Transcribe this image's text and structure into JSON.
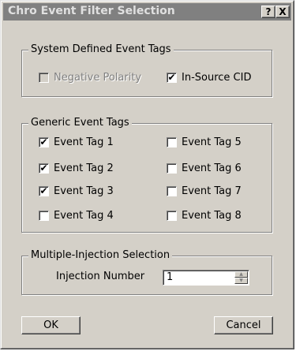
{
  "window": {
    "title": "Chro Event Filter Selection",
    "help_label": "?",
    "close_label": "X"
  },
  "system_group": {
    "label": "System Defined Event Tags",
    "negative_polarity": {
      "label": "Negative Polarity",
      "checked": false,
      "enabled": false
    },
    "in_source_cid": {
      "label": "In-Source CID",
      "checked": true,
      "enabled": true
    }
  },
  "generic_group": {
    "label": "Generic Event Tags",
    "tags": [
      {
        "label": "Event Tag 1",
        "checked": true
      },
      {
        "label": "Event Tag 2",
        "checked": true
      },
      {
        "label": "Event Tag 3",
        "checked": true
      },
      {
        "label": "Event Tag 4",
        "checked": false
      },
      {
        "label": "Event Tag 5",
        "checked": false
      },
      {
        "label": "Event Tag 6",
        "checked": false
      },
      {
        "label": "Event Tag 7",
        "checked": false
      },
      {
        "label": "Event Tag 8",
        "checked": false
      }
    ]
  },
  "injection_group": {
    "label": "Multiple-Injection Selection",
    "field_label": "Injection Number",
    "value": "1"
  },
  "buttons": {
    "ok_label": "OK",
    "cancel_label": "Cancel"
  },
  "check_mark": "✔"
}
